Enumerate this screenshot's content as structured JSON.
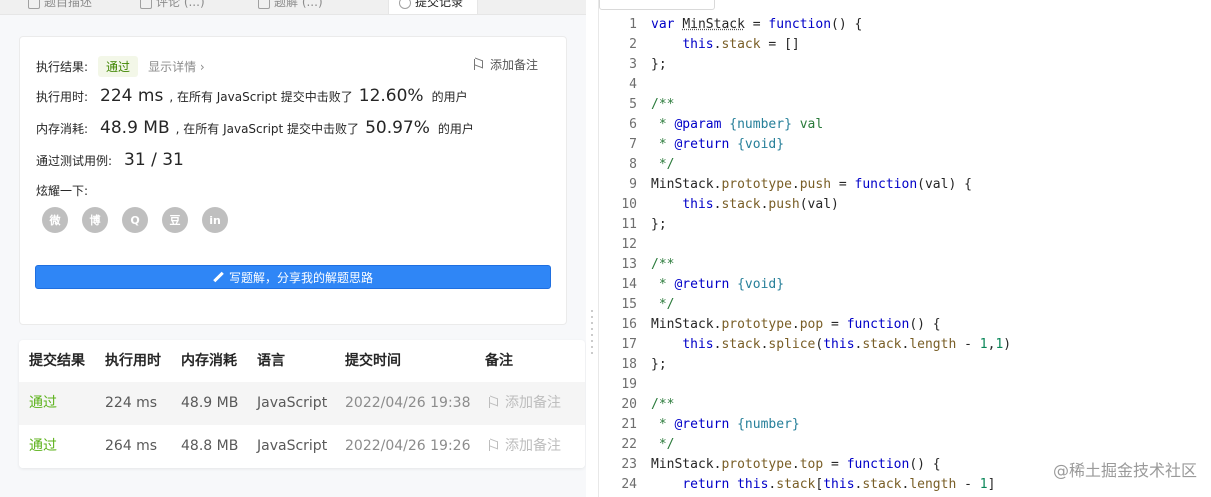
{
  "tabs": [
    {
      "label": "题目描述"
    },
    {
      "label": "评论 (...)"
    },
    {
      "label": "题解 (...)"
    },
    {
      "label": "提交记录"
    }
  ],
  "result": {
    "exec_result_label": "执行结果:",
    "exec_result_value": "通过",
    "show_details": "显示详情 ›",
    "add_note": "添加备注",
    "runtime_label": "执行用时:",
    "runtime_value": "224 ms",
    "runtime_mid": ", 在所有 JavaScript 提交中击败了",
    "runtime_pct": "12.60%",
    "runtime_tail": "的用户",
    "memory_label": "内存消耗:",
    "memory_value": "48.9 MB",
    "memory_mid": ", 在所有 JavaScript 提交中击败了",
    "memory_pct": "50.97%",
    "memory_tail": "的用户",
    "tests_label": "通过测试用例:",
    "tests_value": "31 / 31",
    "share_label": "炫耀一下:",
    "share_icons": [
      "wechat-icon",
      "weibo-icon",
      "qq-icon",
      "douban-icon",
      "linkedin-icon"
    ],
    "share_glyphs": [
      "微",
      "博",
      "Q",
      "豆",
      "in"
    ],
    "write_button": "写题解，分享我的解题思路"
  },
  "table": {
    "headers": [
      "提交结果",
      "执行用时",
      "内存消耗",
      "语言",
      "提交时间",
      "备注"
    ],
    "rows": [
      {
        "status": "通过",
        "runtime": "224 ms",
        "memory": "48.9 MB",
        "lang": "JavaScript",
        "time": "2022/04/26 19:38",
        "note": "添加备注"
      },
      {
        "status": "通过",
        "runtime": "264 ms",
        "memory": "48.8 MB",
        "lang": "JavaScript",
        "time": "2022/04/26 19:26",
        "note": "添加备注"
      }
    ]
  },
  "code": [
    {
      "n": "1",
      "t": "var MinStack = function() {"
    },
    {
      "n": "2",
      "t": "    this.stack = []"
    },
    {
      "n": "3",
      "t": "};"
    },
    {
      "n": "4",
      "t": ""
    },
    {
      "n": "5",
      "t": "/**"
    },
    {
      "n": "6",
      "t": " * @param {number} val"
    },
    {
      "n": "7",
      "t": " * @return {void}"
    },
    {
      "n": "8",
      "t": " */"
    },
    {
      "n": "9",
      "t": "MinStack.prototype.push = function(val) {"
    },
    {
      "n": "10",
      "t": "    this.stack.push(val)"
    },
    {
      "n": "11",
      "t": "};"
    },
    {
      "n": "12",
      "t": ""
    },
    {
      "n": "13",
      "t": "/**"
    },
    {
      "n": "14",
      "t": " * @return {void}"
    },
    {
      "n": "15",
      "t": " */"
    },
    {
      "n": "16",
      "t": "MinStack.prototype.pop = function() {"
    },
    {
      "n": "17",
      "t": "    this.stack.splice(this.stack.length - 1,1)"
    },
    {
      "n": "18",
      "t": "};"
    },
    {
      "n": "19",
      "t": ""
    },
    {
      "n": "20",
      "t": "/**"
    },
    {
      "n": "21",
      "t": " * @return {number}"
    },
    {
      "n": "22",
      "t": " */"
    },
    {
      "n": "23",
      "t": "MinStack.prototype.top = function() {"
    },
    {
      "n": "24",
      "t": "    return this.stack[this.stack.length - 1]"
    }
  ],
  "watermark": "@稀土掘金技术社区",
  "colors": {
    "accent": "#2f86f6",
    "pass": "#5cb21b",
    "keyword": "#0000c8",
    "comment": "#2a7a3a"
  }
}
